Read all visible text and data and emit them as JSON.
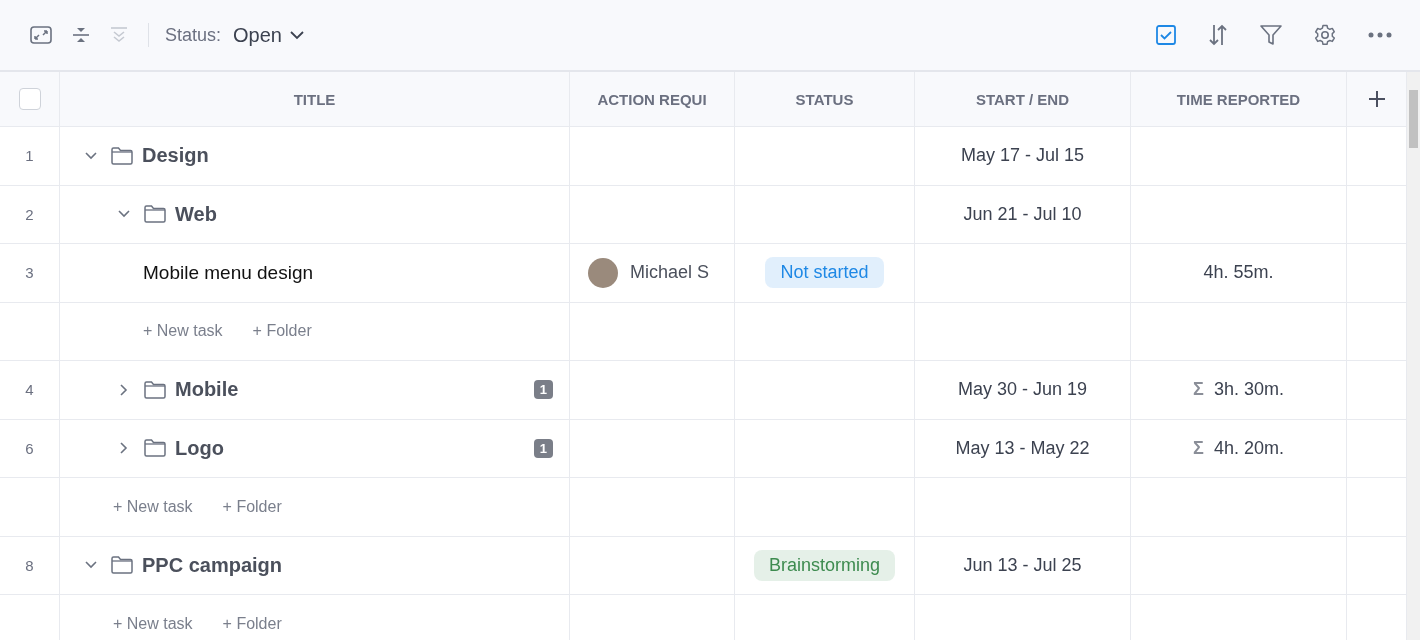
{
  "toolbar": {
    "filter_label": "Status:",
    "filter_value": "Open"
  },
  "table": {
    "select_all": {
      "checked": false
    },
    "columns": [
      "TITLE",
      "ACTION REQUI",
      "STATUS",
      "START / END",
      "TIME REPORTED"
    ],
    "rows": [
      {
        "kind": "folder",
        "number": "1",
        "title": "Design",
        "expanded": true,
        "dates": "May 17 - Jul 15",
        "children": [
          {
            "kind": "folder",
            "number": "2",
            "title": "Web",
            "expanded": true,
            "dates": "Jun 21 - Jul 10",
            "children": [
              {
                "kind": "task",
                "number": "3",
                "title": "Mobile menu design",
                "assignee": "Michael S",
                "status": {
                  "label": "Not started",
                  "color": "#1e88e5"
                },
                "time": {
                  "value": "4h. 55m."
                }
              },
              {
                "kind": "add",
                "new_task": "+ New task",
                "new_folder": "+ Folder"
              }
            ]
          },
          {
            "kind": "folder",
            "number": "4",
            "title": "Mobile",
            "expanded": false,
            "count": "1",
            "dates": "May 30 - Jun 19",
            "time": {
              "prefix": "Σ",
              "value": "3h. 30m."
            }
          },
          {
            "kind": "folder",
            "number": "6",
            "title": "Logo",
            "expanded": false,
            "count": "1",
            "dates": "May 13 - May 22",
            "time": {
              "prefix": "Σ",
              "value": "4h. 20m."
            }
          },
          {
            "kind": "add",
            "new_task": "+ New task",
            "new_folder": "+ Folder"
          }
        ]
      },
      {
        "kind": "folder",
        "number": "8",
        "title": "PPC campaign",
        "expanded": true,
        "status": {
          "label": "Brainstorming",
          "color": "#3d8b4f"
        },
        "dates": "Jun 13 - Jul 25",
        "children": [
          {
            "kind": "add",
            "new_task": "+ New task",
            "new_folder": "+ Folder"
          }
        ]
      }
    ]
  }
}
